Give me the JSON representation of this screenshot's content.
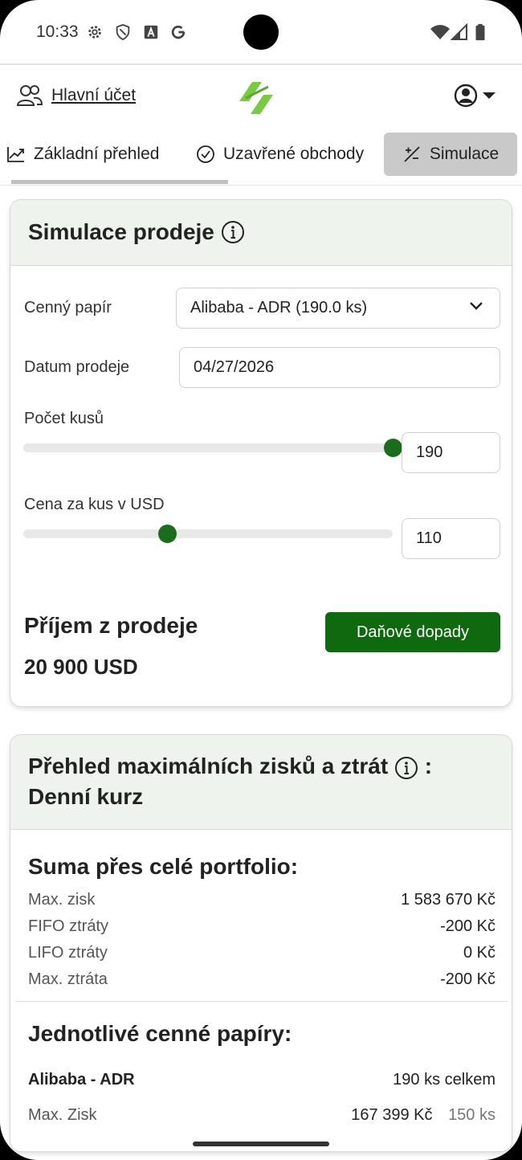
{
  "status": {
    "time": "10:33",
    "icons": [
      "gear-icon",
      "shield-icon",
      "a-icon",
      "google-icon",
      "wifi-icon",
      "signal-icon",
      "battery-icon"
    ]
  },
  "header": {
    "account_label": "Hlavní účet",
    "account_icon": "users-icon",
    "user_icon": "account-circle-icon",
    "accent_color": "#7ac943"
  },
  "tabs": [
    {
      "label": "Základní přehled",
      "icon": "chart-line-icon",
      "active": false
    },
    {
      "label": "Uzavřené obchody",
      "icon": "check-circle-icon",
      "active": false
    },
    {
      "label": "Simulace",
      "icon": "plus-minus-icon",
      "active": true
    }
  ],
  "simulation": {
    "title": "Simulace prodeje",
    "security_label": "Cenný papír",
    "security_value": "Alibaba - ADR (190.0 ks)",
    "date_label": "Datum prodeje",
    "date_value": "04/27/2026",
    "count_label": "Počet kusů",
    "count_value": "190",
    "count_fraction": 1.0,
    "price_label": "Cena za kus v USD",
    "price_value": "110",
    "price_fraction": 0.39,
    "income_label": "Příjem z prodeje",
    "income_value": "20 900 USD",
    "tax_button": "Daňové dopady",
    "accent_color": "#0f6a0f"
  },
  "overview": {
    "title": "Přehled maximálních zisků a ztrát",
    "title_suffix": ":",
    "subtitle": "Denní kurz",
    "portfolio_title": "Suma přes celé portfolio:",
    "rows": [
      {
        "label": "Max. zisk",
        "value": "1 583 670 Kč"
      },
      {
        "label": "FIFO ztráty",
        "value": "-200 Kč"
      },
      {
        "label": "LIFO ztráty",
        "value": "0 Kč"
      },
      {
        "label": "Max. ztráta",
        "value": "-200 Kč"
      }
    ],
    "securities_title": "Jednotlivé cenné papíry:",
    "security": {
      "name": "Alibaba - ADR",
      "total": "190 ks celkem",
      "max_label": "Max. Zisk",
      "max_value": "167 399 Kč",
      "max_count": "150 ks"
    }
  }
}
